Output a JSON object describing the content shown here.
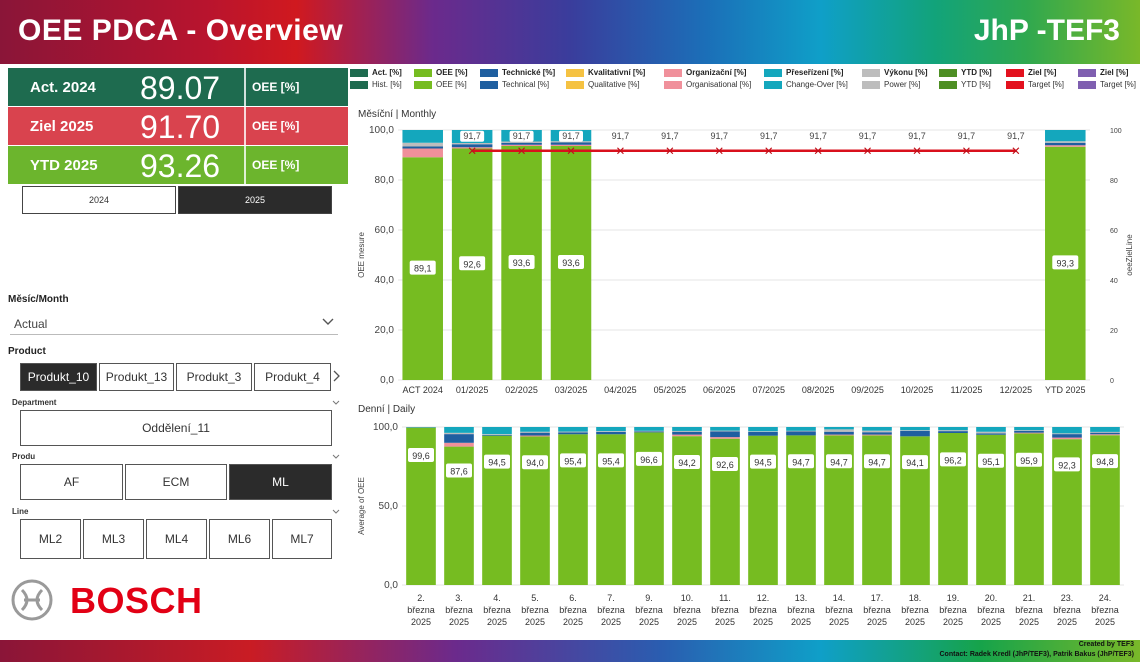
{
  "header": {
    "title": "OEE PDCA - Overview",
    "brand": "JhP -TEF3"
  },
  "kpis": [
    {
      "label": "Act. 2024",
      "value": "89.07",
      "unit": "OEE [%]",
      "color": "#1e6b4f"
    },
    {
      "label": "Ziel 2025",
      "value": "91.70",
      "unit": "OEE [%]",
      "color": "#d9434e"
    },
    {
      "label": "YTD 2025",
      "value": "93.26",
      "unit": "OEE [%]",
      "color": "#6cb52d"
    }
  ],
  "year_toggle": {
    "options": [
      "2024",
      "2025"
    ],
    "selected": "2025"
  },
  "month_filter": {
    "label": "Měsíc/Month",
    "value": "Actual"
  },
  "product_filter": {
    "label": "Product",
    "options": [
      "Produkt_10",
      "Produkt_13",
      "Produkt_3",
      "Produkt_4"
    ],
    "selected": "Produkt_10"
  },
  "department_filter": {
    "label": "Department",
    "value": "Oddělení_11"
  },
  "produ_filter": {
    "label": "Produ",
    "options": [
      "AF",
      "ECM",
      "ML"
    ],
    "selected": "ML"
  },
  "line_filter": {
    "label": "Line",
    "options": [
      "ML2",
      "ML3",
      "ML4",
      "ML6",
      "ML7"
    ]
  },
  "logo": {
    "text": "BOSCH"
  },
  "footer": {
    "created": "Created by TEF3",
    "contact": "Contact: Radek Kredl (JhP/TEF3), Patrik Bakus (JhP/TEF3)"
  },
  "legend": [
    {
      "top": "Act. [%]",
      "bottom": "Hist. [%]",
      "color": "#1e6b4f"
    },
    {
      "top": "OEE [%]",
      "bottom": "OEE [%]",
      "color": "#76bc21"
    },
    {
      "top": "Technické [%]",
      "bottom": "Technical [%]",
      "color": "#1f5fa0"
    },
    {
      "top": "Kvalitativní [%]",
      "bottom": "Qualitative [%]",
      "color": "#f5c242"
    },
    {
      "top": "Organizační [%]",
      "bottom": "Organisational [%]",
      "color": "#f0909b"
    },
    {
      "top": "Přeseřízení [%]",
      "bottom": "Change-Over [%]",
      "color": "#14a7bd"
    },
    {
      "top": "Výkonu [%]",
      "bottom": "Power [%]",
      "color": "#bdbdbd"
    },
    {
      "top": "YTD [%]",
      "bottom": "YTD [%]",
      "color": "#4e8f24"
    },
    {
      "top": "Ziel [%]",
      "bottom": "Target [%]",
      "color": "#e3111e"
    },
    {
      "top": "Ziel [%]",
      "bottom": "Target [%]",
      "color": "#7f5fb0"
    }
  ],
  "chart_data": [
    {
      "type": "bar",
      "title": "Měsíční | Monthly",
      "ylabel": "OEE mesure",
      "y2label": "oeeZielLine",
      "ylim": [
        0,
        100
      ],
      "y2lim": [
        0,
        100
      ],
      "yticks": [
        "0,0",
        "20,0",
        "40,0",
        "60,0",
        "80,0",
        "100,0"
      ],
      "y2ticks": [
        "0",
        "20",
        "40",
        "60",
        "80",
        "100"
      ],
      "categories": [
        "ACT 2024",
        "01/2025",
        "02/2025",
        "03/2025",
        "04/2025",
        "05/2025",
        "06/2025",
        "07/2025",
        "08/2025",
        "09/2025",
        "10/2025",
        "11/2025",
        "12/2025",
        "YTD 2025"
      ],
      "series": [
        {
          "name": "OEE [%]",
          "values": [
            89.1,
            92.6,
            93.6,
            93.6,
            null,
            null,
            null,
            null,
            null,
            null,
            null,
            null,
            null,
            93.3
          ]
        },
        {
          "name": "Organizační [%]",
          "values": [
            3.5,
            0.5,
            0.5,
            0.5,
            null,
            null,
            null,
            null,
            null,
            null,
            null,
            null,
            null,
            0.6
          ]
        },
        {
          "name": "Technické [%]",
          "values": [
            0.8,
            1.2,
            0.8,
            0.9,
            null,
            null,
            null,
            null,
            null,
            null,
            null,
            null,
            null,
            1.0
          ]
        },
        {
          "name": "Výkonu [%]",
          "values": [
            1.5,
            0.5,
            0.5,
            0.5,
            null,
            null,
            null,
            null,
            null,
            null,
            null,
            null,
            null,
            0.6
          ]
        },
        {
          "name": "Přeseřízení [%]",
          "values": [
            5.1,
            5.2,
            4.6,
            4.5,
            null,
            null,
            null,
            null,
            null,
            null,
            null,
            null,
            null,
            4.5
          ]
        }
      ],
      "value_labels": [
        "89,1",
        "92,6",
        "93,6",
        "93,6",
        "",
        "",
        "",
        "",
        "",
        "",
        "",
        "",
        "",
        "93,3"
      ],
      "target_labels": [
        "",
        "91,7",
        "91,7",
        "91,7",
        "91,7",
        "91,7",
        "91,7",
        "91,7",
        "91,7",
        "91,7",
        "91,7",
        "91,7",
        "91,7",
        ""
      ],
      "target_line": {
        "name": "Ziel [%]",
        "values": [
          null,
          91.7,
          91.7,
          91.7,
          91.7,
          91.7,
          91.7,
          91.7,
          91.7,
          91.7,
          91.7,
          91.7,
          91.7,
          null
        ]
      }
    },
    {
      "type": "bar",
      "title": "Denní | Daily",
      "ylabel": "Average of OEE",
      "ylim": [
        0,
        100
      ],
      "yticks": [
        "0,0",
        "50,0",
        "100,0"
      ],
      "categories": [
        [
          "2.",
          "března",
          "2025"
        ],
        [
          "3.",
          "března",
          "2025"
        ],
        [
          "4.",
          "března",
          "2025"
        ],
        [
          "5.",
          "března",
          "2025"
        ],
        [
          "6.",
          "března",
          "2025"
        ],
        [
          "7.",
          "března",
          "2025"
        ],
        [
          "9.",
          "března",
          "2025"
        ],
        [
          "10.",
          "března",
          "2025"
        ],
        [
          "11.",
          "března",
          "2025"
        ],
        [
          "12.",
          "března",
          "2025"
        ],
        [
          "13.",
          "března",
          "2025"
        ],
        [
          "14.",
          "března",
          "2025"
        ],
        [
          "17.",
          "března",
          "2025"
        ],
        [
          "18.",
          "března",
          "2025"
        ],
        [
          "19.",
          "března",
          "2025"
        ],
        [
          "20.",
          "března",
          "2025"
        ],
        [
          "21.",
          "března",
          "2025"
        ],
        [
          "23.",
          "března",
          "2025"
        ],
        [
          "24.",
          "března",
          "2025"
        ]
      ],
      "series": [
        {
          "name": "OEE [%]",
          "values": [
            99.6,
            87.6,
            94.5,
            94.0,
            95.4,
            95.4,
            96.6,
            94.2,
            92.6,
            94.5,
            94.7,
            94.7,
            94.7,
            94.1,
            96.2,
            95.1,
            95.9,
            92.3,
            94.8
          ]
        },
        {
          "name": "Organizační [%]",
          "values": [
            0,
            2.4,
            0,
            0.6,
            0,
            0,
            0,
            1.0,
            1.0,
            0,
            0,
            0.5,
            0.5,
            0,
            0,
            0,
            0.5,
            1.0,
            0.6
          ]
        },
        {
          "name": "Technické [%]",
          "values": [
            0.2,
            5.5,
            0.5,
            1.8,
            1.2,
            1.5,
            0.6,
            1.8,
            3.6,
            2.4,
            2.5,
            1.8,
            1.5,
            3.5,
            1.2,
            0.8,
            1.2,
            2.2,
            1.0
          ]
        },
        {
          "name": "Výkonu [%]",
          "values": [
            0,
            0.8,
            0.5,
            0.6,
            0.5,
            0.5,
            0.4,
            0.5,
            0.5,
            0.4,
            0.4,
            1.5,
            1.0,
            0.4,
            0.6,
            1.1,
            0.4,
            0.5,
            0.5
          ]
        },
        {
          "name": "Přeseřízení [%]",
          "values": [
            0.2,
            3.7,
            4.5,
            3.0,
            2.9,
            2.6,
            2.4,
            2.5,
            2.3,
            2.7,
            2.4,
            1.5,
            2.3,
            2.0,
            2.0,
            3.0,
            2.0,
            4.0,
            3.1
          ]
        }
      ],
      "value_labels": [
        "99,6",
        "87,6",
        "94,5",
        "94,0",
        "95,4",
        "95,4",
        "96,6",
        "94,2",
        "92,6",
        "94,5",
        "94,7",
        "94,7",
        "94,7",
        "94,1",
        "96,2",
        "95,1",
        "95,9",
        "92,3",
        "94,8"
      ]
    }
  ]
}
